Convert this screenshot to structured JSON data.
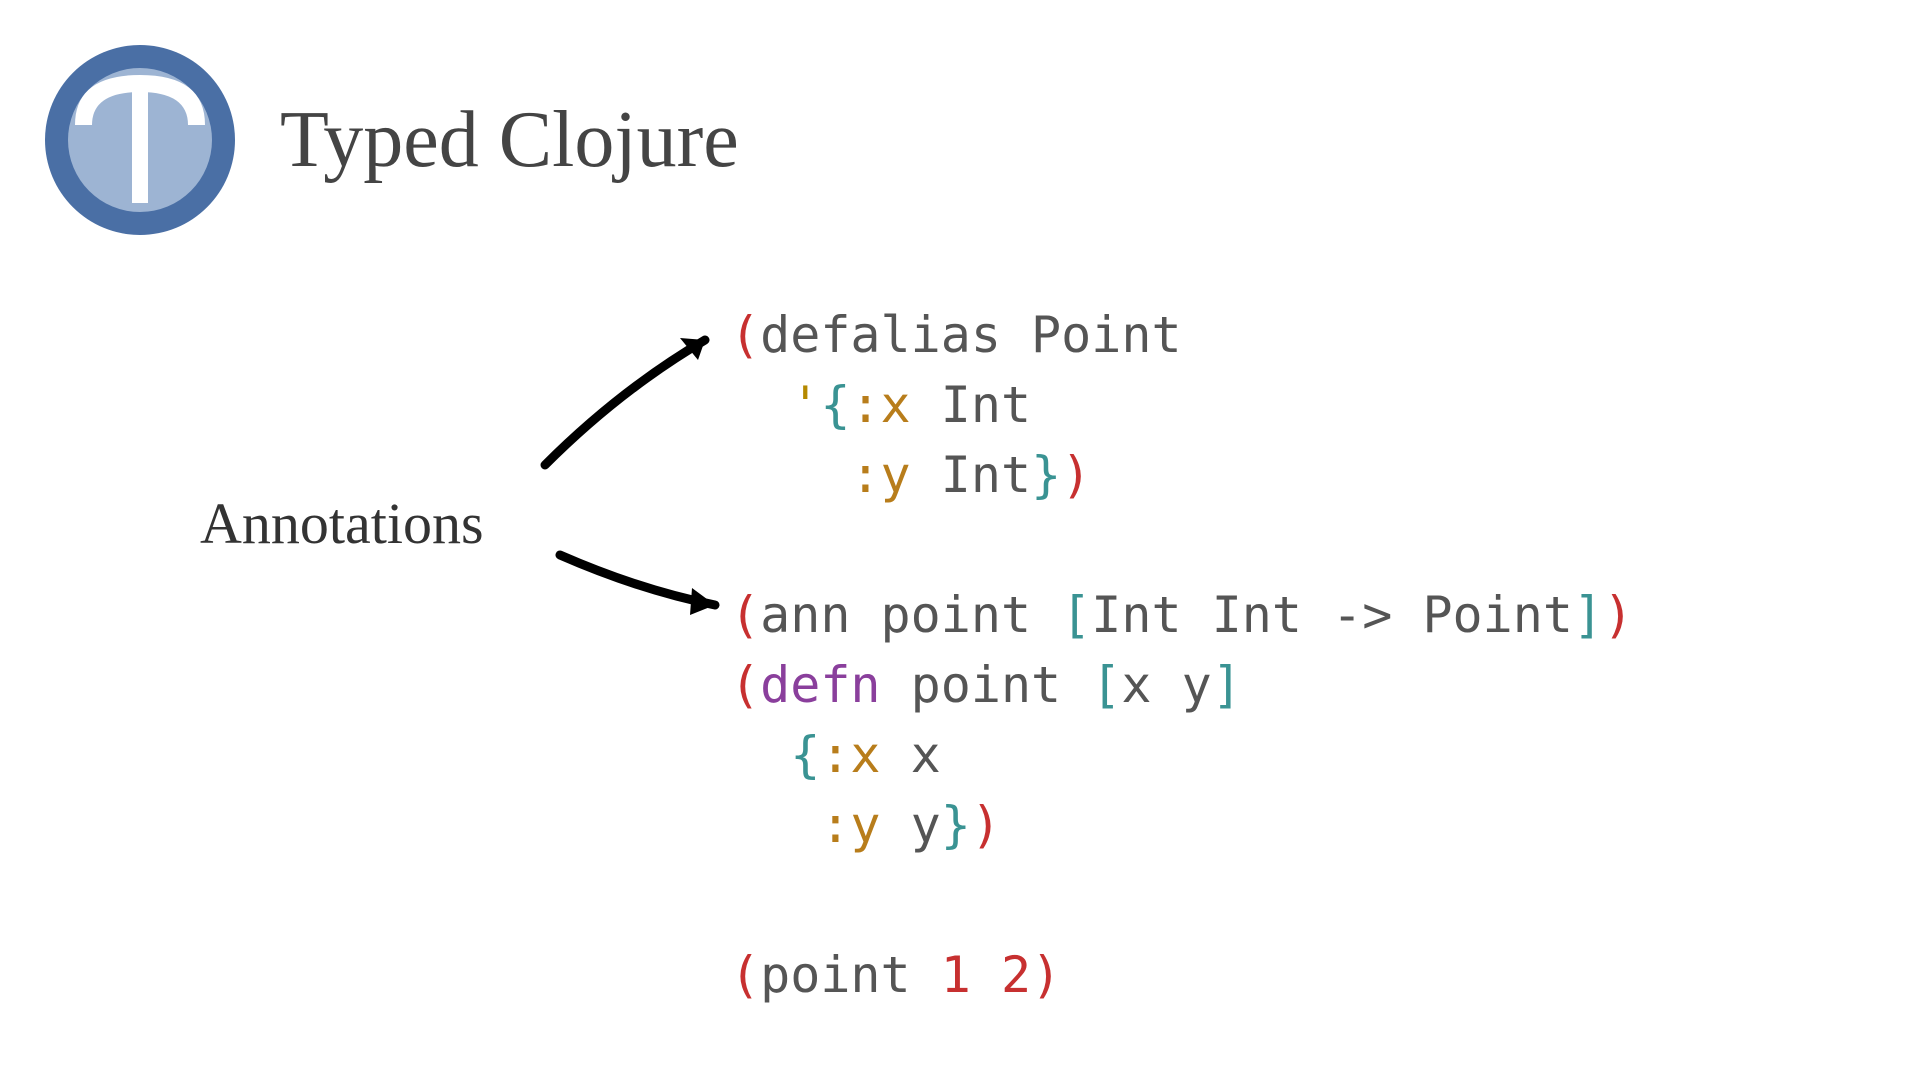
{
  "title": "Typed Clojure",
  "annotations_label": "Annotations",
  "logo": {
    "ring_color": "#4a6fa5",
    "inner_color": "#9db4d3",
    "letter_color": "#ffffff"
  },
  "code": {
    "defalias": {
      "lp1": "(",
      "defalias": "defalias",
      "sp1": " ",
      "point_type": "Point",
      "nl1": "\n  ",
      "quote": "'",
      "lb1": "{",
      "kx": ":x",
      "sp2": " ",
      "int1": "Int",
      "nl2": "\n    ",
      "ky": ":y",
      "sp3": " ",
      "int2": "Int",
      "rb1": "}",
      "rp1": ")"
    },
    "ann": {
      "lp1": "(",
      "ann": "ann",
      "sp1": " ",
      "point_fn": "point",
      "sp2": " ",
      "lsq1": "[",
      "int1": "Int",
      "sp3": " ",
      "int2": "Int",
      "sp4": " ",
      "arrow": "->",
      "sp5": " ",
      "point_type": "Point",
      "rsq1": "]",
      "rp1": ")",
      "nl1": "\n",
      "lp2": "(",
      "defn": "defn",
      "sp6": " ",
      "point_fn2": "point",
      "sp7": " ",
      "lsq2": "[",
      "x": "x",
      "sp8": " ",
      "y": "y",
      "rsq2": "]",
      "nl2": "\n  ",
      "lb1": "{",
      "kx": ":x",
      "sp9": " ",
      "xv": "x",
      "nl3": "\n   ",
      "ky": ":y",
      "sp10": " ",
      "yv": "y",
      "rb1": "}",
      "rp2": ")"
    },
    "call": {
      "lp1": "(",
      "point": "point",
      "sp1": " ",
      "one": "1",
      "sp2": " ",
      "two": "2",
      "rp1": ")"
    }
  }
}
